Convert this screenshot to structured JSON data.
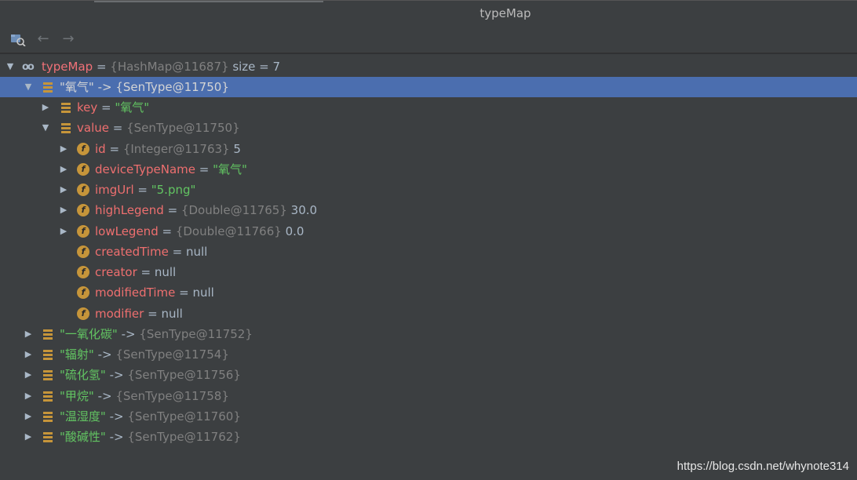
{
  "window": {
    "title": "typeMap"
  },
  "toolbar": {
    "icons": [
      "inspect-icon",
      "back-arrow-icon",
      "forward-arrow-icon"
    ]
  },
  "tree": {
    "root": {
      "name": "typeMap",
      "eq": " = ",
      "type": "{HashMap@11687}",
      "extra": " size = 7"
    },
    "entry0": {
      "key": "\"氧气\"",
      "arrow": " -> ",
      "type": "{SenType@11750}"
    },
    "key_row": {
      "name": "key",
      "eq": " = ",
      "value": "\"氧气\""
    },
    "value_row": {
      "name": "value",
      "eq": " = ",
      "type": "{SenType@11750}"
    },
    "fields": [
      {
        "name": "id",
        "eq": " = ",
        "type": "{Integer@11763}",
        "value": " 5"
      },
      {
        "name": "deviceTypeName",
        "eq": " = ",
        "str": "\"氧气\""
      },
      {
        "name": "imgUrl",
        "eq": " = ",
        "str": "\"5.png\""
      },
      {
        "name": "highLegend",
        "eq": " = ",
        "type": "{Double@11765}",
        "value": " 30.0"
      },
      {
        "name": "lowLegend",
        "eq": " = ",
        "type": "{Double@11766}",
        "value": " 0.0"
      },
      {
        "name": "createdTime",
        "eq": " = ",
        "value": "null"
      },
      {
        "name": "creator",
        "eq": " = ",
        "value": "null"
      },
      {
        "name": "modifiedTime",
        "eq": " = ",
        "value": "null"
      },
      {
        "name": "modifier",
        "eq": " = ",
        "value": "null"
      }
    ],
    "entries": [
      {
        "key": "\"一氧化碳\"",
        "arrow": " -> ",
        "type": "{SenType@11752}"
      },
      {
        "key": "\"辐射\"",
        "arrow": " -> ",
        "type": "{SenType@11754}"
      },
      {
        "key": "\"硫化氢\"",
        "arrow": " -> ",
        "type": "{SenType@11756}"
      },
      {
        "key": "\"甲烷\"",
        "arrow": " -> ",
        "type": "{SenType@11758}"
      },
      {
        "key": "\"温湿度\"",
        "arrow": " -> ",
        "type": "{SenType@11760}"
      },
      {
        "key": "\"酸碱性\"",
        "arrow": " -> ",
        "type": "{SenType@11762}"
      }
    ]
  },
  "watermark": "https://blog.csdn.net/whynote314"
}
